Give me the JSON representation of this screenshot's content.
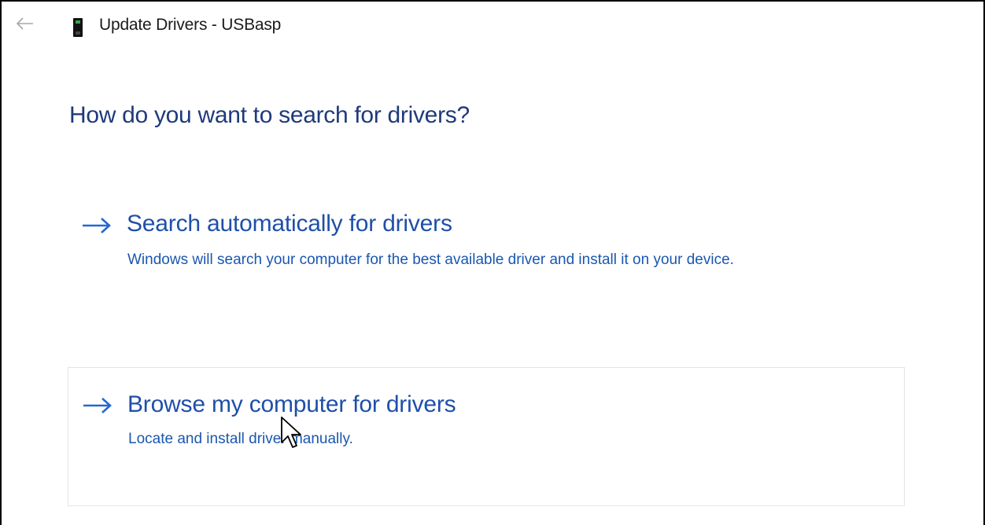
{
  "window": {
    "title": "Update Drivers - USBasp"
  },
  "main": {
    "heading": "How do you want to search for drivers?",
    "options": [
      {
        "title": "Search automatically for drivers",
        "description": "Windows will search your computer for the best available driver and install it on your device."
      },
      {
        "title": "Browse my computer for drivers",
        "description": "Locate and install driver manually."
      }
    ]
  },
  "icons": {
    "back": "back-arrow-icon",
    "device": "usb-device-icon",
    "option_arrow": "right-arrow-icon",
    "cursor": "mouse-pointer-icon"
  },
  "colors": {
    "heading": "#1f3a7a",
    "link_title": "#1f4fa8",
    "link_description": "#1a57b0",
    "arrow": "#2468d4",
    "border": "#000000"
  }
}
